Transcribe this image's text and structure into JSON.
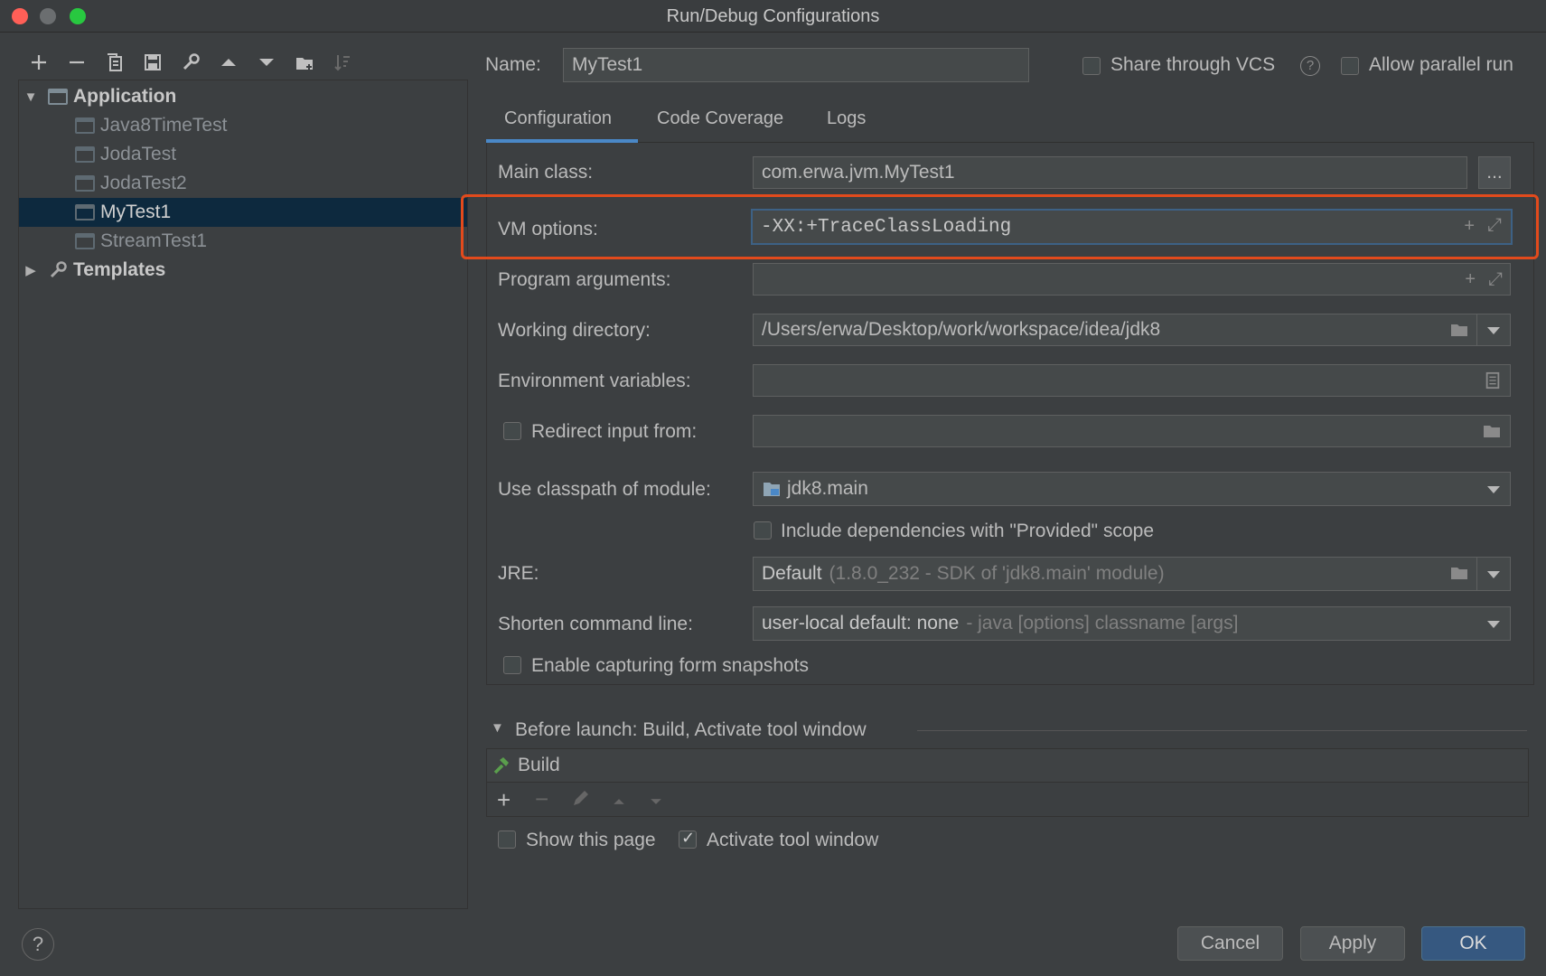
{
  "window": {
    "title": "Run/Debug Configurations"
  },
  "toolbar": {
    "buttons": [
      "add-icon",
      "remove-icon",
      "copy-icon",
      "save-icon",
      "wrench-icon",
      "move-up-icon",
      "move-down-icon",
      "new-folder-icon",
      "sort-icon"
    ]
  },
  "tree": {
    "application_label": "Application",
    "items": [
      {
        "label": "Java8TimeTest"
      },
      {
        "label": "JodaTest"
      },
      {
        "label": "JodaTest2"
      },
      {
        "label": "MyTest1",
        "selected": true
      },
      {
        "label": "StreamTest1"
      }
    ],
    "templates_label": "Templates"
  },
  "header": {
    "name_label": "Name:",
    "name_value": "MyTest1",
    "share_vcs_label": "Share through VCS",
    "allow_parallel_label": "Allow parallel run"
  },
  "tabs": [
    {
      "label": "Configuration",
      "active": true
    },
    {
      "label": "Code Coverage"
    },
    {
      "label": "Logs"
    }
  ],
  "config": {
    "main_class_label": "Main class:",
    "main_class_value": "com.erwa.jvm.MyTest1",
    "browse_label": "...",
    "vm_options_label": "VM options:",
    "vm_options_value": "-XX:+TraceClassLoading",
    "program_args_label": "Program arguments:",
    "program_args_value": "",
    "working_dir_label": "Working directory:",
    "working_dir_value": "/Users/erwa/Desktop/work/workspace/idea/jdk8",
    "env_vars_label": "Environment variables:",
    "env_vars_value": "",
    "redirect_label": "Redirect input from:",
    "redirect_value": "",
    "classpath_label": "Use classpath of module:",
    "classpath_value": "jdk8.main",
    "include_deps_label": "Include dependencies with \"Provided\" scope",
    "jre_label": "JRE:",
    "jre_value": "Default",
    "jre_detail": "(1.8.0_232 - SDK of 'jdk8.main' module)",
    "shorten_label": "Shorten command line:",
    "shorten_value": "user-local default: none",
    "shorten_detail": "- java [options] classname [args]",
    "snapshots_label": "Enable capturing form snapshots"
  },
  "before_launch": {
    "header": "Before launch: Build, Activate tool window",
    "items": [
      {
        "label": "Build"
      }
    ],
    "show_page_label": "Show this page",
    "activate_label": "Activate tool window"
  },
  "footer": {
    "help_label": "?",
    "cancel_label": "Cancel",
    "apply_label": "Apply",
    "ok_label": "OK"
  },
  "colors": {
    "accent": "#4a88c7",
    "highlight_box": "#e24a1c",
    "selection": "#0d293e",
    "ok_button": "#365880"
  }
}
